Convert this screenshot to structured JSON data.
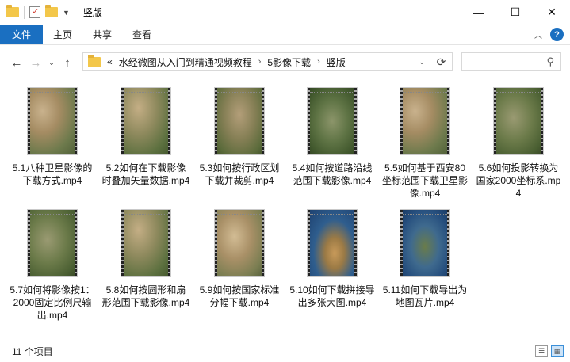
{
  "window": {
    "title": "竖版",
    "minimize": "—",
    "maximize": "☐",
    "close": "✕"
  },
  "ribbon": {
    "tabs": [
      {
        "label": "文件"
      },
      {
        "label": "主页"
      },
      {
        "label": "共享"
      },
      {
        "label": "查看"
      }
    ],
    "collapse_icon": "chevron-up-icon",
    "help_icon": "?"
  },
  "nav": {
    "back": "←",
    "forward": "→",
    "recent": "⌄",
    "up": "↑",
    "breadcrumb": [
      {
        "label": "«"
      },
      {
        "label": "水经微图从入门到精通视频教程"
      },
      {
        "label": "5影像下载"
      },
      {
        "label": "竖版"
      }
    ],
    "separator": "›",
    "refresh": "⟳",
    "search_icon": "⚲"
  },
  "files": [
    {
      "name": "5.1八种卫星影像的下载方式.mp4",
      "tone": "desert"
    },
    {
      "name": "5.2如何在下载影像时叠加矢量数据.mp4",
      "tone": "mixed"
    },
    {
      "name": "5.3如何按行政区划下载并裁剪.mp4",
      "tone": "mixed2"
    },
    {
      "name": "5.4如何按道路沿线范围下载影像.mp4",
      "tone": "green"
    },
    {
      "name": "5.5如何基于西安80坐标范围下载卫星影像.mp4",
      "tone": "desert"
    },
    {
      "name": "5.6如何投影转换为国家2000坐标系.mp4",
      "tone": "green2"
    },
    {
      "name": "5.7如何将影像按1：2000固定比例尺输出.mp4",
      "tone": "green2"
    },
    {
      "name": "5.8如何按圆形和扇形范围下载影像.mp4",
      "tone": "mixed"
    },
    {
      "name": "5.9如何按国家标准分幅下载.mp4",
      "tone": "desert2"
    },
    {
      "name": "5.10如何下载拼接导出多张大图.mp4",
      "tone": "globe"
    },
    {
      "name": "5.11如何下载导出为地图瓦片.mp4",
      "tone": "globe2"
    }
  ],
  "status": {
    "count": "11 个项目"
  },
  "colors": {
    "accent": "#1a6fc1",
    "folder": "#f3c74a"
  }
}
